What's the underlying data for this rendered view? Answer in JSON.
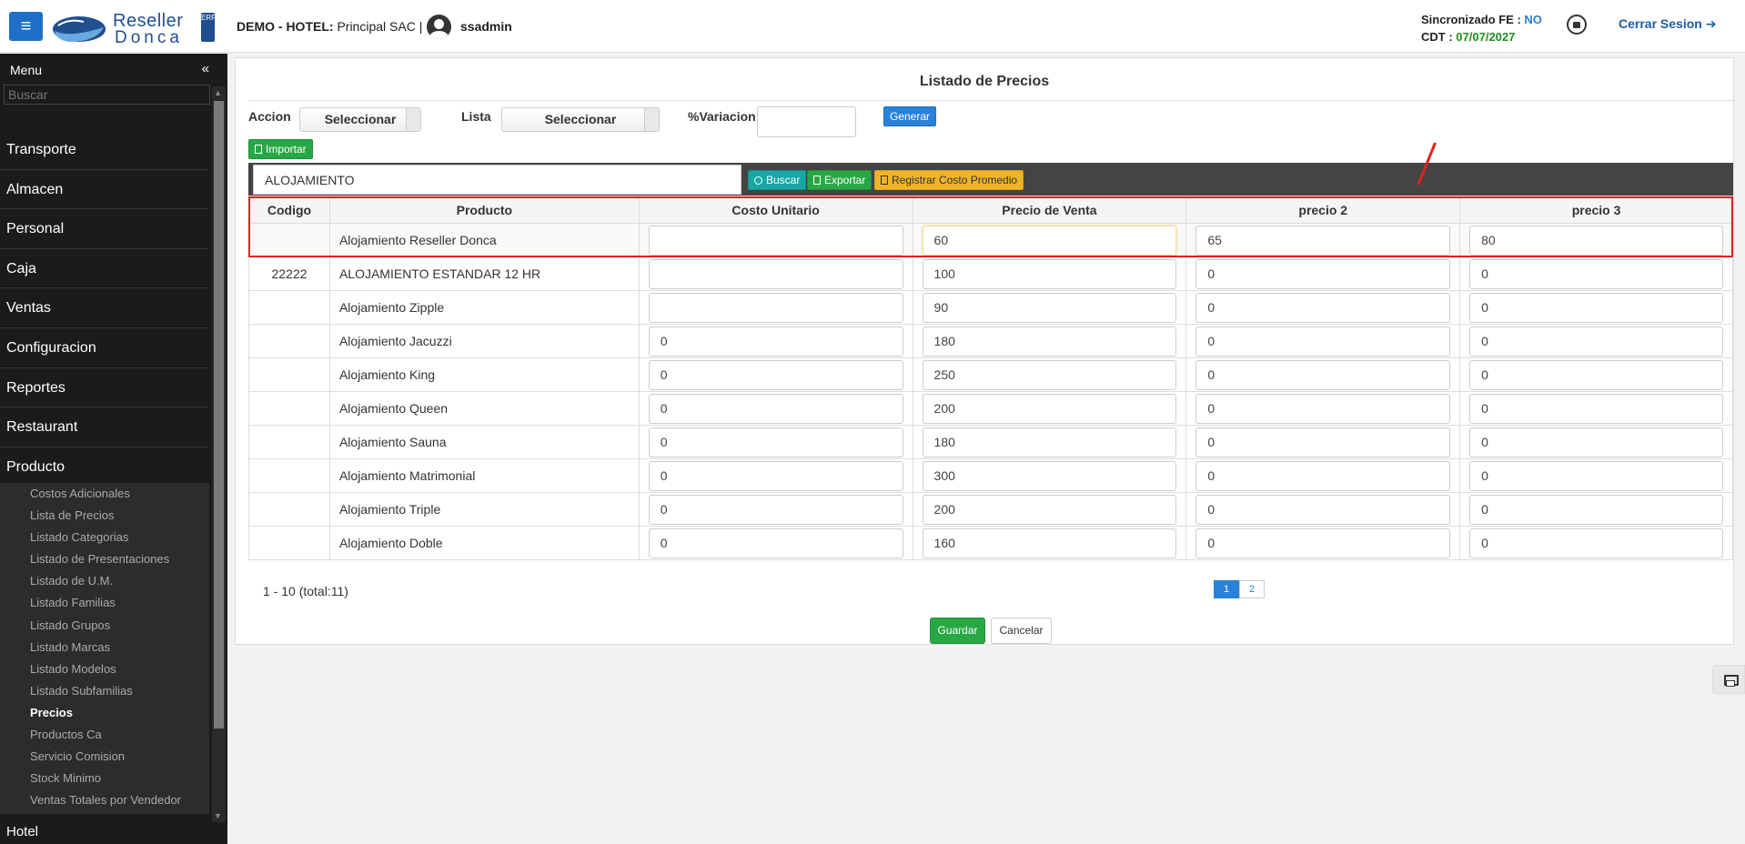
{
  "header": {
    "logo_line1": "Reseller",
    "logo_line2": "Donca",
    "logo_badge": "ERP",
    "company_label": "DEMO - HOTEL:",
    "company_value": "Principal SAC |",
    "username": "ssadmin",
    "sync_label": "Sincronizado FE :",
    "sync_value": "NO",
    "cdt_label": "CDT :",
    "cdt_value": "07/07/2027",
    "logout_label": "Cerrar Sesion"
  },
  "sidebar": {
    "title": "Menu",
    "search_placeholder": "Buscar",
    "items": [
      "Transporte",
      "Almacen",
      "Personal",
      "Caja",
      "Ventas",
      "Configuracion",
      "Reportes",
      "Restaurant",
      "Producto"
    ],
    "subitems": [
      "Costos Adicionales",
      "Lista de Precios",
      "Listado Categorias",
      "Listado de Presentaciones",
      "Listado de U.M.",
      "Listado Familias",
      "Listado Grupos",
      "Listado Marcas",
      "Listado Modelos",
      "Listado Subfamilias",
      "Precios",
      "Productos Ca",
      "Servicio Comision",
      "Stock Minimo",
      "Ventas Totales por Vendedor"
    ],
    "active_subitem": "Precios",
    "partial_item": "Hotel"
  },
  "page": {
    "title": "Listado de Precios",
    "accion_label": "Accion",
    "accion_value": "Seleccionar",
    "lista_label": "Lista",
    "lista_value": "Seleccionar",
    "variacion_label": "%Variacion",
    "generar_label": "Generar",
    "importar_label": "Importar",
    "search_value": "ALOJAMIENTO",
    "buscar_label": "Buscar",
    "exportar_label": "Exportar",
    "registrar_label": "Registrar Costo Promedio"
  },
  "table": {
    "headers": [
      "Codigo",
      "Producto",
      "Costo Unitario",
      "Precio de Venta",
      "precio 2",
      "precio 3"
    ],
    "rows": [
      {
        "codigo": "",
        "producto": "Alojamiento Reseller Donca",
        "costo": "",
        "venta": "60",
        "p2": "65",
        "p3": "80"
      },
      {
        "codigo": "22222",
        "producto": "ALOJAMIENTO ESTANDAR 12 HR",
        "costo": "",
        "venta": "100",
        "p2": "0",
        "p3": "0"
      },
      {
        "codigo": "",
        "producto": "Alojamiento Zipple",
        "costo": "",
        "venta": "90",
        "p2": "0",
        "p3": "0"
      },
      {
        "codigo": "",
        "producto": "Alojamiento Jacuzzi",
        "costo": "0",
        "venta": "180",
        "p2": "0",
        "p3": "0"
      },
      {
        "codigo": "",
        "producto": "Alojamiento King",
        "costo": "0",
        "venta": "250",
        "p2": "0",
        "p3": "0"
      },
      {
        "codigo": "",
        "producto": "Alojamiento Queen",
        "costo": "0",
        "venta": "200",
        "p2": "0",
        "p3": "0"
      },
      {
        "codigo": "",
        "producto": "Alojamiento Sauna",
        "costo": "0",
        "venta": "180",
        "p2": "0",
        "p3": "0"
      },
      {
        "codigo": "",
        "producto": "Alojamiento Matrimonial",
        "costo": "0",
        "venta": "300",
        "p2": "0",
        "p3": "0"
      },
      {
        "codigo": "",
        "producto": "Alojamiento Triple",
        "costo": "0",
        "venta": "200",
        "p2": "0",
        "p3": "0"
      },
      {
        "codigo": "",
        "producto": "Alojamiento Doble",
        "costo": "0",
        "venta": "160",
        "p2": "0",
        "p3": "0"
      }
    ]
  },
  "pagination": {
    "info": "1 - 10 (total:11)",
    "pages": [
      "1",
      "2"
    ]
  },
  "actions": {
    "save_label": "Guardar",
    "cancel_label": "Cancelar"
  },
  "colors": {
    "primary": "#1e6fc7",
    "success": "#27a844",
    "highlight": "#e02020"
  }
}
